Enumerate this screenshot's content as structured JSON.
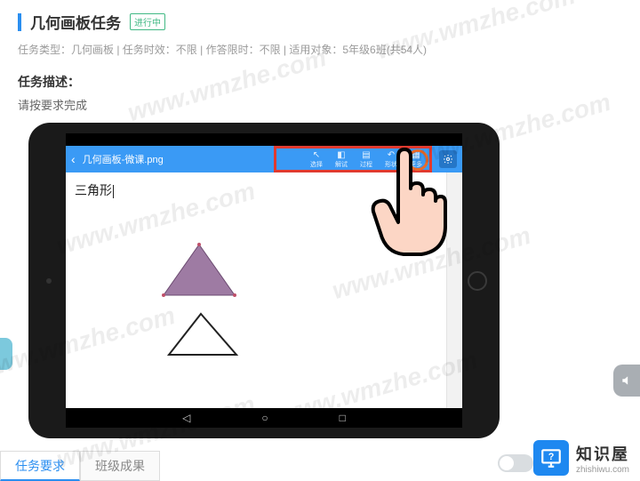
{
  "header": {
    "title": "几何画板任务",
    "badge": "进行中",
    "meta": "任务类型：几何画板 | 任务时效：不限 | 作答限时：不限 | 适用对象：5年级6班(共54人)",
    "desc_label": "任务描述：",
    "desc_text": "请按要求完成"
  },
  "app": {
    "file_name": "几何画板-微课.png",
    "canvas_text": "三角形",
    "toolbar": [
      "选择",
      "解试",
      "过程",
      "形状",
      "更多"
    ]
  },
  "tabs": {
    "active": "任务要求",
    "other": "班级成果"
  },
  "brand": {
    "cn": "知识屋",
    "en": "zhishiwu.com"
  },
  "watermark": "www.wmzhe.com",
  "colors": {
    "accent": "#2a8ef0",
    "highlight": "#e03a2f",
    "triangle": "#9e7ba3"
  }
}
